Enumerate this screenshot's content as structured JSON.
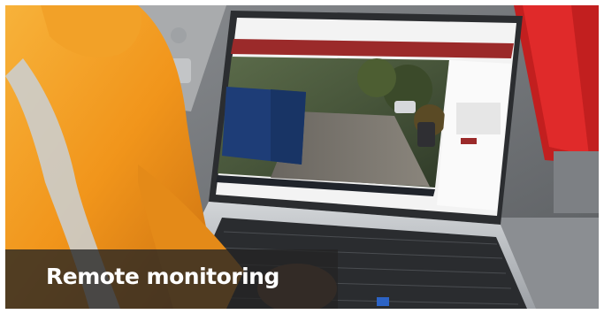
{
  "caption": {
    "text": "Remote monitoring"
  },
  "scene": {
    "description_items": [
      "safety-jacket",
      "laptop",
      "camera-feed",
      "red-equipment-housing"
    ]
  },
  "colors": {
    "jacket_orange": "#f4a021",
    "laptop_silver": "#b9bcc0",
    "screen_ui_red": "#9b2a2a",
    "caption_bg": "#242424"
  }
}
